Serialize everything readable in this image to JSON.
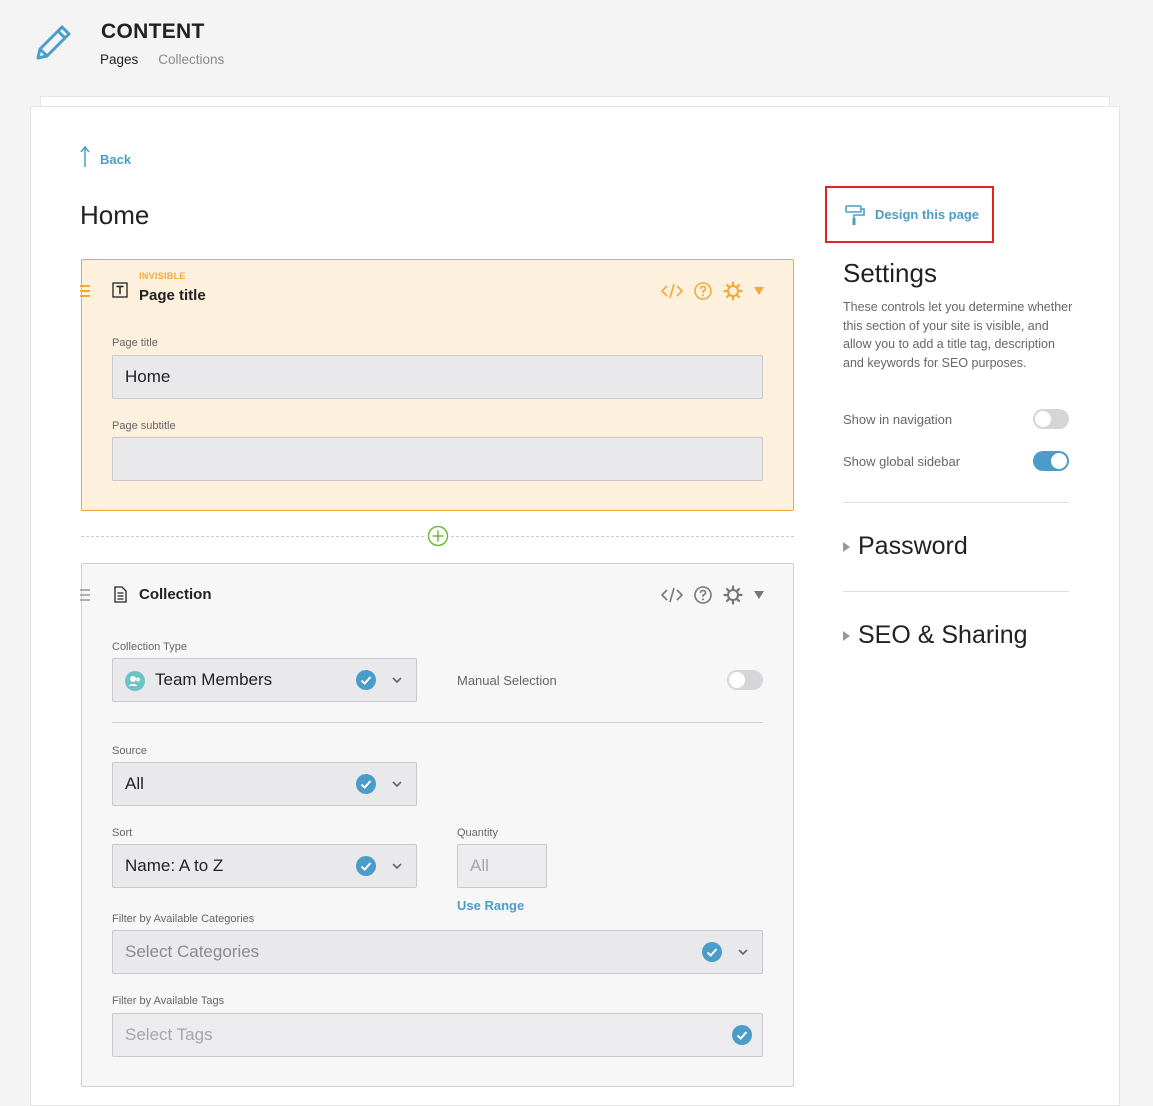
{
  "header": {
    "title": "CONTENT",
    "tabs": [
      {
        "label": "Pages",
        "active": true
      },
      {
        "label": "Collections",
        "active": false
      }
    ]
  },
  "nav": {
    "back_label": "Back"
  },
  "page": {
    "heading": "Home"
  },
  "page_title_section": {
    "badge": "INVISIBLE",
    "title": "Page title",
    "fields": {
      "page_title": {
        "label": "Page title",
        "value": "Home"
      },
      "page_subtitle": {
        "label": "Page subtitle",
        "value": ""
      }
    }
  },
  "collection_section": {
    "title": "Collection",
    "collection_type": {
      "label": "Collection Type",
      "value": "Team Members"
    },
    "manual_selection": {
      "label": "Manual Selection",
      "enabled": false
    },
    "source": {
      "label": "Source",
      "value": "All"
    },
    "sort": {
      "label": "Sort",
      "value": "Name: A to Z"
    },
    "quantity": {
      "label": "Quantity",
      "value": "All",
      "range_link": "Use Range"
    },
    "filter_categories": {
      "label": "Filter by Available Categories",
      "placeholder": "Select Categories"
    },
    "filter_tags": {
      "label": "Filter by Available Tags",
      "placeholder": "Select Tags"
    }
  },
  "sidebar": {
    "design_link": "Design this page",
    "settings_title": "Settings",
    "settings_description": "These controls let you determine whether this section of your site is visible, and allow you to add a title tag, description and keywords for SEO purposes.",
    "show_in_navigation": {
      "label": "Show in navigation",
      "enabled": false
    },
    "show_global_sidebar": {
      "label": "Show global sidebar",
      "enabled": true
    },
    "password_label": "Password",
    "seo_label": "SEO & Sharing"
  },
  "colors": {
    "accent": "#4b9ec7",
    "warning": "#f2a93b",
    "highlight_box": "#e02424",
    "add_green": "#6dbb3b"
  }
}
